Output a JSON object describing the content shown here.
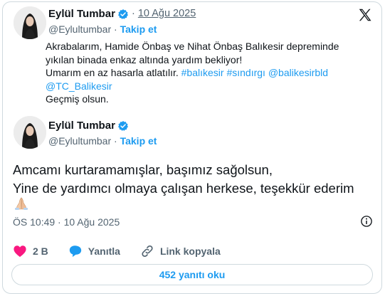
{
  "quoted": {
    "name": "Eylül Tumbar",
    "date": "10 Ağu 2025",
    "handle": "@Eylultumbar",
    "follow_label": "Takip et",
    "text_line1": "Akrabalarım, Hamide Önbaş ve Nihat Önbaş Balıkesir depreminde",
    "text_line2": "yıkılan binada enkaz altında yardım bekliyor!",
    "text_line3": "Umarım en az hasarla atlatılır.",
    "hashtag1": "#balıkesir",
    "hashtag2": "#sındırgı",
    "mention1": "@balikesirbld",
    "mention2": "@TC_Balikesir",
    "text_line5": "Geçmiş olsun."
  },
  "post": {
    "name": "Eylül Tumbar",
    "handle": "@Eylultumbar",
    "follow_label": "Takip et",
    "text_line1": "Amcamı kurtaramamışlar, başımız sağolsun,",
    "text_line2": "Yine de yardımcı olmaya çalışan herkese, teşekkür ederim",
    "timestamp": "ÖS 10:49 · 10 Ağu 2025"
  },
  "actions": {
    "like_count": "2 B",
    "reply_label": "Yanıtla",
    "copy_link_label": "Link kopyala"
  },
  "replies_button": "452 yanıtı oku",
  "colors": {
    "accent": "#1d9bf0",
    "like": "#f91880",
    "text": "#0f1419",
    "muted": "#536471",
    "border": "#cfd9de"
  },
  "icons": [
    "x-logo-icon",
    "verified-badge-icon",
    "heart-icon",
    "reply-bubble-icon",
    "link-icon",
    "info-icon",
    "praying-hands-icon"
  ]
}
